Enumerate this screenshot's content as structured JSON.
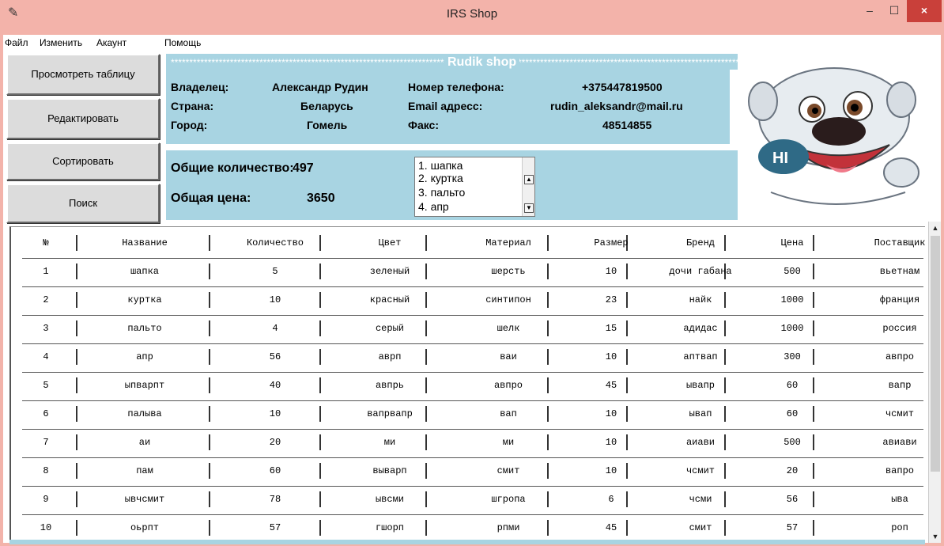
{
  "window": {
    "title": "IRS Shop",
    "min_glyph": "–",
    "max_glyph": "☐",
    "close_glyph": "×",
    "app_glyph": "✎"
  },
  "menu": [
    "Файл",
    "Изменить",
    "Акаунт",
    "Помощь"
  ],
  "side_buttons": [
    "Просмотреть таблицу",
    "Редактировать",
    "Сортировать",
    "Поиск"
  ],
  "shop": {
    "banner_fill": "*****************************************************************************************************************************************************************************",
    "name": "Rudik shop",
    "owner_label": "Владелец:",
    "owner_value": "Александр Рудин",
    "country_label": "Страна:",
    "country_value": "Беларусь",
    "city_label": "Город:",
    "city_value": "Гомель",
    "phone_label": "Номер телефона:",
    "phone_value": "+375447819500",
    "email_label": "Email адресс:",
    "email_value": "rudin_aleksandr@mail.ru",
    "fax_label": "Факс:",
    "fax_value": "48514855"
  },
  "stats": {
    "count_label": "Общие количество:",
    "count_value": "497",
    "price_label": "Общая цена:",
    "price_value": "3650"
  },
  "listbox": [
    "1. шапка",
    "2. куртка",
    "3. пальто",
    "4. апр"
  ],
  "table": {
    "headers": [
      "№",
      "Название",
      "Количество",
      "Цвет",
      "Материал",
      "Размер",
      "Бренд",
      "Цена",
      "Поставщик"
    ],
    "rows": [
      [
        "1",
        "шапка",
        "5",
        "зеленый",
        "шерсть",
        "10",
        "дочи габана",
        "500",
        "вьетнам"
      ],
      [
        "2",
        "куртка",
        "10",
        "красный",
        "синтипон",
        "23",
        "найк",
        "1000",
        "франция"
      ],
      [
        "3",
        "пальто",
        "4",
        "серый",
        "шелк",
        "15",
        "адидас",
        "1000",
        "россия"
      ],
      [
        "4",
        "апр",
        "56",
        "аврп",
        "ваи",
        "10",
        "аптвап",
        "300",
        "авпро"
      ],
      [
        "5",
        "ыпварпт",
        "40",
        "авпрь",
        "авпро",
        "45",
        "ывапр",
        "60",
        "вапр"
      ],
      [
        "6",
        "палыва",
        "10",
        "вапрвапр",
        "вап",
        "10",
        "ывап",
        "60",
        "чсмит"
      ],
      [
        "7",
        "аи",
        "20",
        "ми",
        "ми",
        "10",
        "аиави",
        "500",
        "авиави"
      ],
      [
        "8",
        "пам",
        "60",
        "выварп",
        "смит",
        "10",
        "чсмит",
        "20",
        "вапро"
      ],
      [
        "9",
        "ывчсмит",
        "78",
        "ывсми",
        "шгропа",
        "6",
        "чсми",
        "56",
        "ыва"
      ],
      [
        "10",
        "оьрпт",
        "57",
        "гшорп",
        "рпми",
        "45",
        "смит",
        "57",
        "роп"
      ]
    ]
  },
  "colors": {
    "panel": "#a8d4e2",
    "titlebar": "#f3b3aa",
    "close": "#c9403a",
    "button": "#dcdcdc"
  },
  "icons": {
    "mascot": "cartoon-dog-hi-image",
    "mascot_bubble": "HI"
  }
}
